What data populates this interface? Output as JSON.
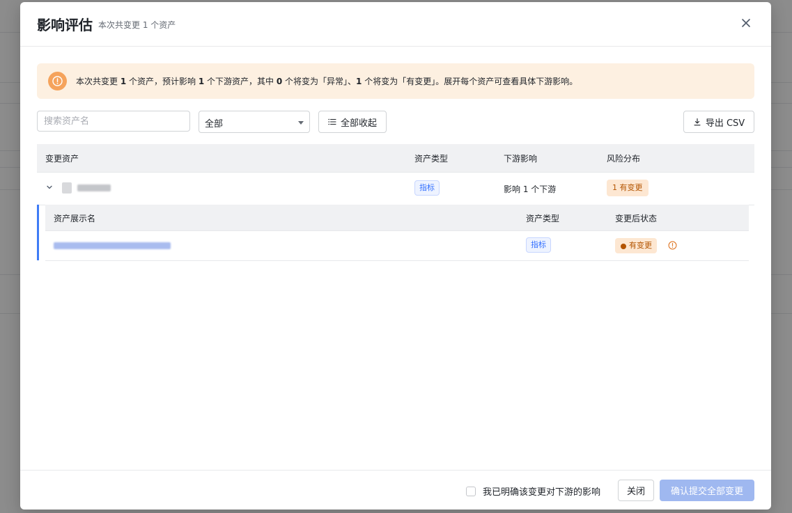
{
  "modal": {
    "title": "影响评估",
    "subtitle": "本次共变更 1 个资产",
    "close_icon": "close-icon"
  },
  "alert": {
    "icon": "warning-circle-icon",
    "parts": [
      "本次共变更 ",
      "1",
      " 个资产，预计影响 ",
      "1",
      " 个下游资产，其中 ",
      "0",
      " 个将变为「异常」、",
      "1",
      " 个将变为「有变更」。展开每个资产可查看具体下游影响。"
    ]
  },
  "toolbar": {
    "search_placeholder": "搜索资产名",
    "filter_value": "全部",
    "collapse_label": "全部收起",
    "export_label": "导出 CSV"
  },
  "table": {
    "headers": [
      "变更资产",
      "资产类型",
      "下游影响",
      "风险分布"
    ],
    "rows": [
      {
        "type": "指标",
        "impact": "影响 1 个下游",
        "risk": "1 有变更"
      }
    ]
  },
  "subtable": {
    "headers": [
      "资产展示名",
      "资产类型",
      "变更后状态"
    ],
    "rows": [
      {
        "type": "指标",
        "status": "有变更"
      }
    ]
  },
  "footer": {
    "ack_label": "我已明确该变更对下游的影响",
    "close_label": "关闭",
    "confirm_label": "确认提交全部变更"
  },
  "colors": {
    "accent": "#3370ff",
    "warning": "#f5a35c",
    "alert_bg": "#fdf0e1",
    "changed": "#b35400"
  }
}
